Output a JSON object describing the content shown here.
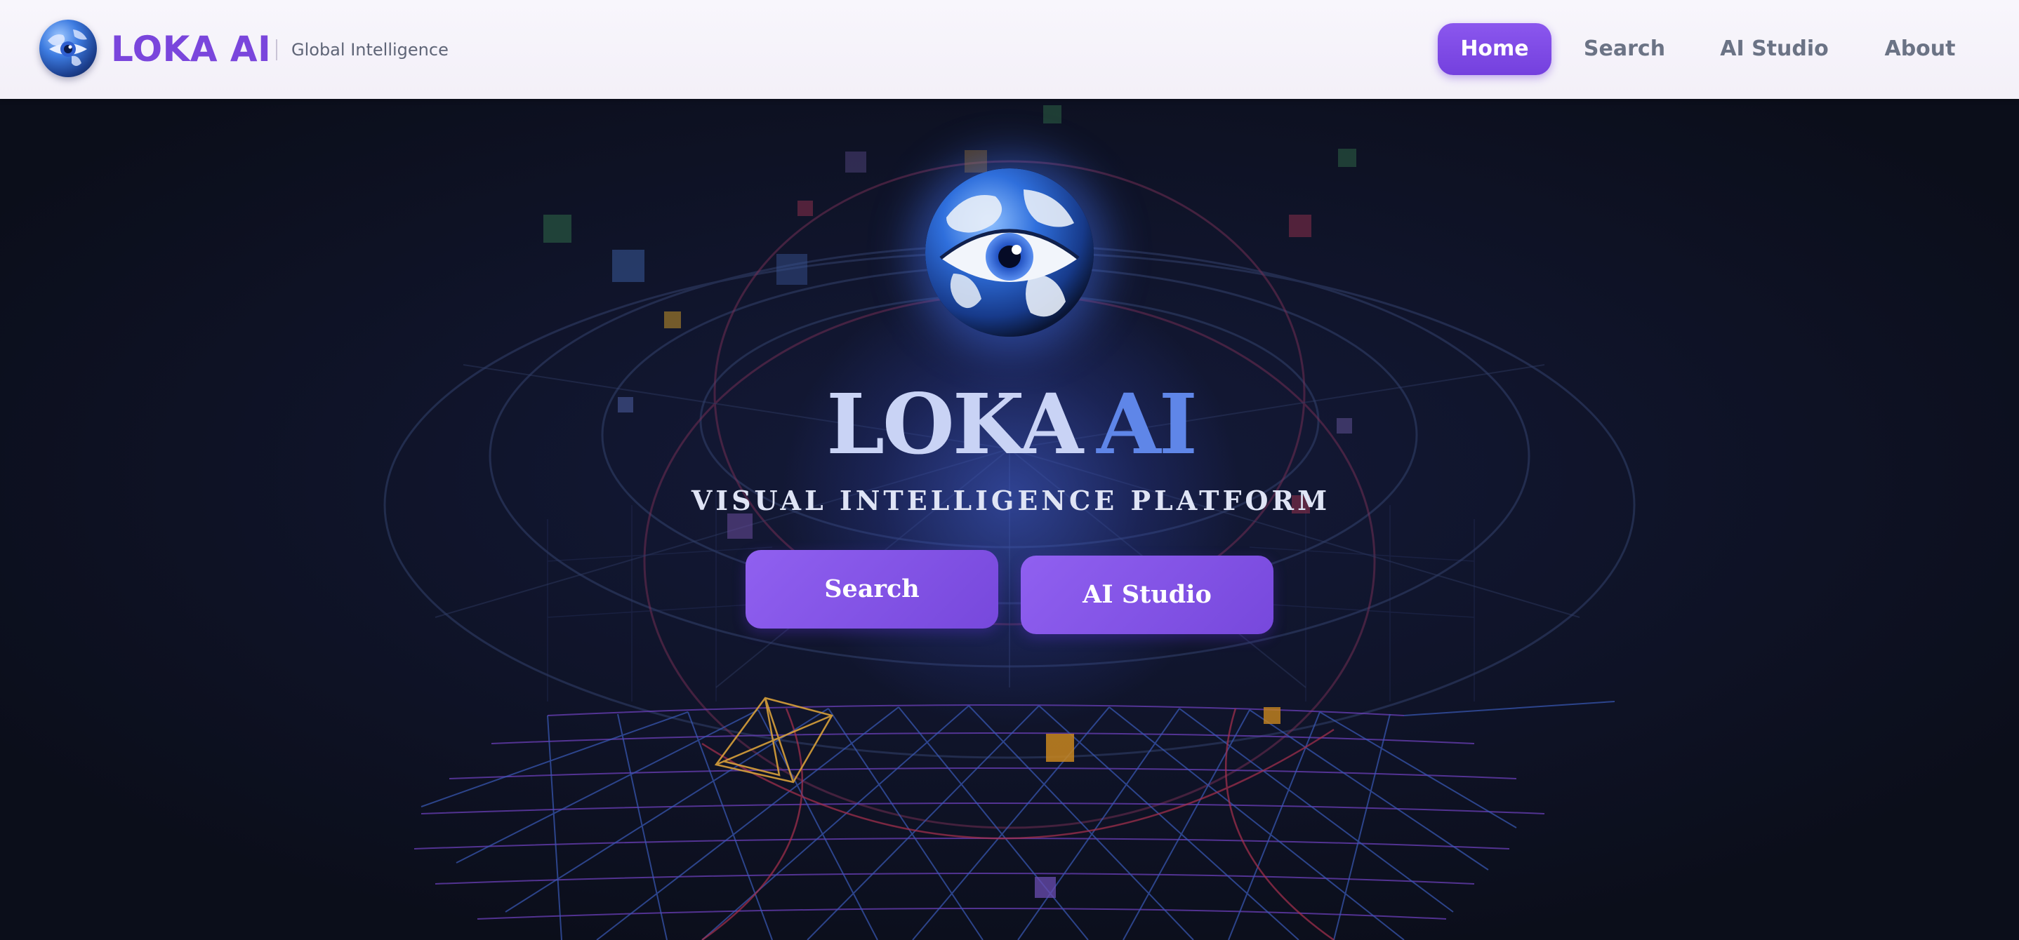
{
  "header": {
    "brand_name": "LOKA AI",
    "tagline": "Global Intelligence",
    "nav": [
      {
        "label": "Home",
        "active": true
      },
      {
        "label": "Search",
        "active": false
      },
      {
        "label": "AI Studio",
        "active": false
      },
      {
        "label": "About",
        "active": false
      }
    ]
  },
  "hero": {
    "title_part1": "LOKA",
    "title_part2": "AI",
    "subtitle": "VISUAL INTELLIGENCE PLATFORM",
    "buttons": [
      {
        "label": "Search"
      },
      {
        "label": "AI Studio"
      }
    ]
  },
  "icons": {
    "logo": "globe-eye-icon",
    "emblem": "globe-eye-icon"
  },
  "colors": {
    "accent": "#7a46dc",
    "button": "#8352e8",
    "background": "#0b0e1a",
    "title_light": "#c9d3f5",
    "title_blue": "#5f86e8"
  }
}
